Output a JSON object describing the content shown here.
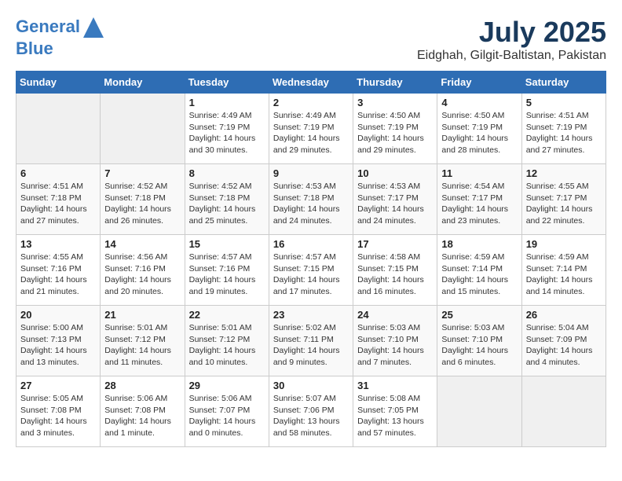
{
  "header": {
    "logo_line1": "General",
    "logo_line2": "Blue",
    "month_year": "July 2025",
    "location": "Eidghah, Gilgit-Baltistan, Pakistan"
  },
  "weekdays": [
    "Sunday",
    "Monday",
    "Tuesday",
    "Wednesday",
    "Thursday",
    "Friday",
    "Saturday"
  ],
  "weeks": [
    [
      {
        "day": "",
        "info": ""
      },
      {
        "day": "",
        "info": ""
      },
      {
        "day": "1",
        "info": "Sunrise: 4:49 AM\nSunset: 7:19 PM\nDaylight: 14 hours\nand 30 minutes."
      },
      {
        "day": "2",
        "info": "Sunrise: 4:49 AM\nSunset: 7:19 PM\nDaylight: 14 hours\nand 29 minutes."
      },
      {
        "day": "3",
        "info": "Sunrise: 4:50 AM\nSunset: 7:19 PM\nDaylight: 14 hours\nand 29 minutes."
      },
      {
        "day": "4",
        "info": "Sunrise: 4:50 AM\nSunset: 7:19 PM\nDaylight: 14 hours\nand 28 minutes."
      },
      {
        "day": "5",
        "info": "Sunrise: 4:51 AM\nSunset: 7:19 PM\nDaylight: 14 hours\nand 27 minutes."
      }
    ],
    [
      {
        "day": "6",
        "info": "Sunrise: 4:51 AM\nSunset: 7:18 PM\nDaylight: 14 hours\nand 27 minutes."
      },
      {
        "day": "7",
        "info": "Sunrise: 4:52 AM\nSunset: 7:18 PM\nDaylight: 14 hours\nand 26 minutes."
      },
      {
        "day": "8",
        "info": "Sunrise: 4:52 AM\nSunset: 7:18 PM\nDaylight: 14 hours\nand 25 minutes."
      },
      {
        "day": "9",
        "info": "Sunrise: 4:53 AM\nSunset: 7:18 PM\nDaylight: 14 hours\nand 24 minutes."
      },
      {
        "day": "10",
        "info": "Sunrise: 4:53 AM\nSunset: 7:17 PM\nDaylight: 14 hours\nand 24 minutes."
      },
      {
        "day": "11",
        "info": "Sunrise: 4:54 AM\nSunset: 7:17 PM\nDaylight: 14 hours\nand 23 minutes."
      },
      {
        "day": "12",
        "info": "Sunrise: 4:55 AM\nSunset: 7:17 PM\nDaylight: 14 hours\nand 22 minutes."
      }
    ],
    [
      {
        "day": "13",
        "info": "Sunrise: 4:55 AM\nSunset: 7:16 PM\nDaylight: 14 hours\nand 21 minutes."
      },
      {
        "day": "14",
        "info": "Sunrise: 4:56 AM\nSunset: 7:16 PM\nDaylight: 14 hours\nand 20 minutes."
      },
      {
        "day": "15",
        "info": "Sunrise: 4:57 AM\nSunset: 7:16 PM\nDaylight: 14 hours\nand 19 minutes."
      },
      {
        "day": "16",
        "info": "Sunrise: 4:57 AM\nSunset: 7:15 PM\nDaylight: 14 hours\nand 17 minutes."
      },
      {
        "day": "17",
        "info": "Sunrise: 4:58 AM\nSunset: 7:15 PM\nDaylight: 14 hours\nand 16 minutes."
      },
      {
        "day": "18",
        "info": "Sunrise: 4:59 AM\nSunset: 7:14 PM\nDaylight: 14 hours\nand 15 minutes."
      },
      {
        "day": "19",
        "info": "Sunrise: 4:59 AM\nSunset: 7:14 PM\nDaylight: 14 hours\nand 14 minutes."
      }
    ],
    [
      {
        "day": "20",
        "info": "Sunrise: 5:00 AM\nSunset: 7:13 PM\nDaylight: 14 hours\nand 13 minutes."
      },
      {
        "day": "21",
        "info": "Sunrise: 5:01 AM\nSunset: 7:12 PM\nDaylight: 14 hours\nand 11 minutes."
      },
      {
        "day": "22",
        "info": "Sunrise: 5:01 AM\nSunset: 7:12 PM\nDaylight: 14 hours\nand 10 minutes."
      },
      {
        "day": "23",
        "info": "Sunrise: 5:02 AM\nSunset: 7:11 PM\nDaylight: 14 hours\nand 9 minutes."
      },
      {
        "day": "24",
        "info": "Sunrise: 5:03 AM\nSunset: 7:10 PM\nDaylight: 14 hours\nand 7 minutes."
      },
      {
        "day": "25",
        "info": "Sunrise: 5:03 AM\nSunset: 7:10 PM\nDaylight: 14 hours\nand 6 minutes."
      },
      {
        "day": "26",
        "info": "Sunrise: 5:04 AM\nSunset: 7:09 PM\nDaylight: 14 hours\nand 4 minutes."
      }
    ],
    [
      {
        "day": "27",
        "info": "Sunrise: 5:05 AM\nSunset: 7:08 PM\nDaylight: 14 hours\nand 3 minutes."
      },
      {
        "day": "28",
        "info": "Sunrise: 5:06 AM\nSunset: 7:08 PM\nDaylight: 14 hours\nand 1 minute."
      },
      {
        "day": "29",
        "info": "Sunrise: 5:06 AM\nSunset: 7:07 PM\nDaylight: 14 hours\nand 0 minutes."
      },
      {
        "day": "30",
        "info": "Sunrise: 5:07 AM\nSunset: 7:06 PM\nDaylight: 13 hours\nand 58 minutes."
      },
      {
        "day": "31",
        "info": "Sunrise: 5:08 AM\nSunset: 7:05 PM\nDaylight: 13 hours\nand 57 minutes."
      },
      {
        "day": "",
        "info": ""
      },
      {
        "day": "",
        "info": ""
      }
    ]
  ]
}
